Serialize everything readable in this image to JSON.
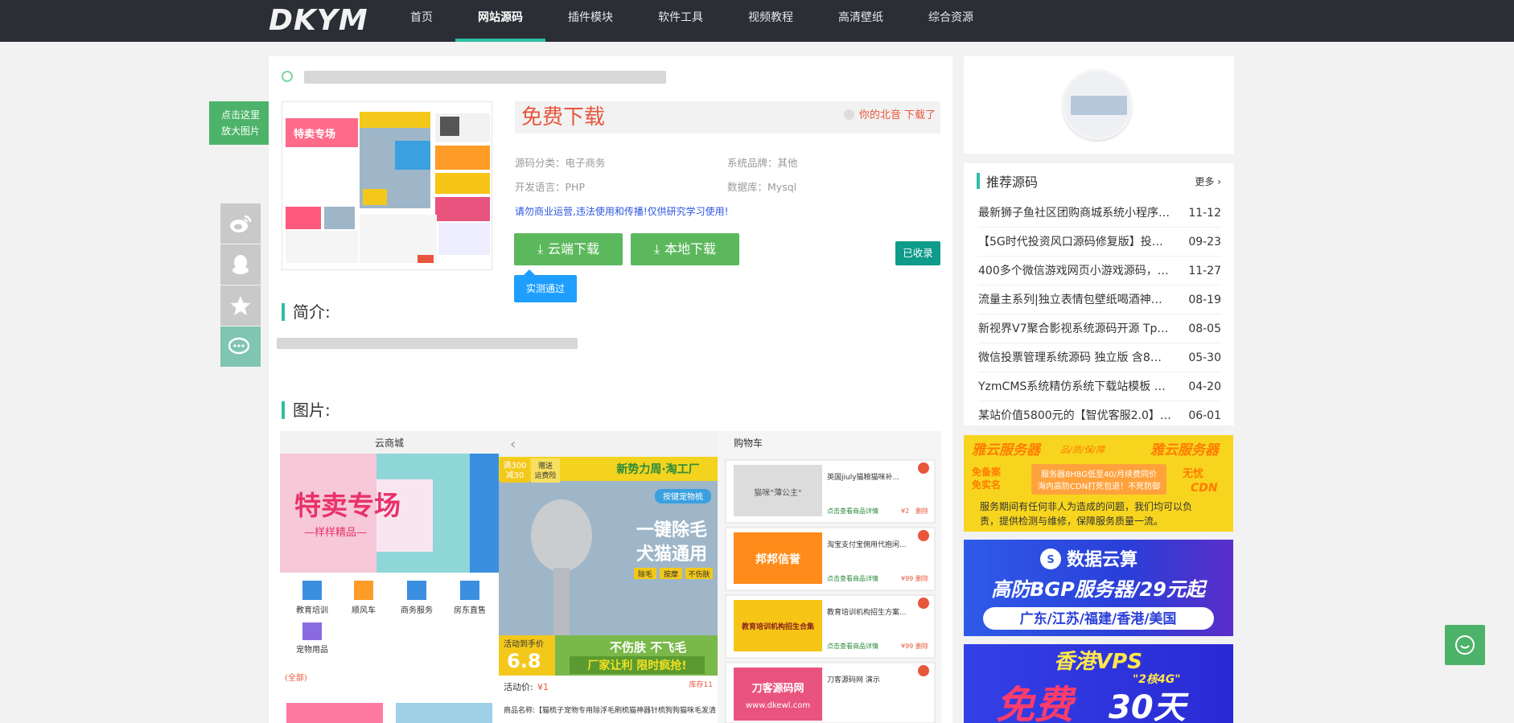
{
  "header": {
    "logo": "DKYM",
    "nav": [
      "首页",
      "网站源码",
      "插件模块",
      "软件工具",
      "视频教程",
      "高清壁纸",
      "综合资源"
    ],
    "active_nav": "网站源码"
  },
  "zoom_tip": [
    "点击这里",
    "放大图片"
  ],
  "product": {
    "free_download": "免费下载",
    "listen": "你的北音 下载了",
    "category_label": "源码分类：",
    "category": "电子商务",
    "brand_label": "系统品牌：",
    "brand": "其他",
    "language_label": "开发语言：",
    "language": "PHP",
    "db_label": "数据库：",
    "db": "Mysql",
    "notice": "请勿商业运营,违法使用和传播!仅供研究学习使用!",
    "cloud_download": "云端下载",
    "local_download": "本地下载",
    "collected": "已收录",
    "tested": "实测通过"
  },
  "sections": {
    "intro": "简介:",
    "images": "图片:"
  },
  "screenshot": {
    "col1_title": "云商城",
    "col1_banner": "特卖专场",
    "col1_banner_sub": "—样样精品—",
    "col1_icons": [
      "教育培训",
      "顺风车",
      "商务服务",
      "房东直售",
      "宠物用品"
    ],
    "col1_footer": "(全部)",
    "col2_banner_top": "新势力周·淘工厂",
    "col2_tag": "按键宠物梳",
    "col2_slogan1": "一键除毛",
    "col2_slogan2": "犬猫通用",
    "col2_badges": [
      "除毛",
      "按摩",
      "不伤肤"
    ],
    "col2_gift": "满300减30",
    "col2_gift2": "赠送运费险",
    "col2_price_tag": "活动到手价",
    "col2_price": "6.8",
    "col2_price_unit": "起",
    "col2_line1": "不伤肤 不飞毛",
    "col2_line2": "厂家让利 限时疯抢!",
    "col2_act_label": "活动价:",
    "col2_act_price": "¥1",
    "col2_stock": "库存11",
    "col2_desc": "商品名称:【猫梳子宠物专用除浮毛刷梳猫神器针梳狗狗猫咪毛发清",
    "col3_title": "购物车",
    "cart": [
      {
        "name": "英国jiuly猫粮猫咪补...",
        "tag": "JHLY",
        "title": "猫咪\"薄公主\"",
        "link": "点击查看商品详情",
        "price": "¥2",
        "del": "删除"
      },
      {
        "name": "淘宝支付宝佣用代抱闲...",
        "title": "邦邦信誉",
        "link": "点击查看商品详情",
        "price": "¥99",
        "del": "删除"
      },
      {
        "name": "教育培训机构招生方案...",
        "title": "教育培训机构招生合集",
        "link": "点击查看商品详情",
        "price": "¥99",
        "del": "删除"
      },
      {
        "name": "刀客源码网 演示",
        "title": "刀客源码网",
        "sub": "www.dkewl.com",
        "link": "点击查看商品详情",
        "price": "¥99",
        "del": "删除"
      }
    ]
  },
  "sidebar": {
    "rec_title": "推荐源码",
    "rec_more": "更多",
    "rec_items": [
      {
        "title": "最新狮子鱼社区团购商城系统小程序v1...",
        "date": "11-12"
      },
      {
        "title": "【5G时代投资风口源码修复版】投资区...",
        "date": "09-23"
      },
      {
        "title": "400多个微信游戏网页小游戏源码，测...",
        "date": "11-27"
      },
      {
        "title": "流量主系列|独立表情包壁纸喝酒神器功...",
        "date": "08-19"
      },
      {
        "title": "新视界V7聚合影视系统源码开源 Tp内...",
        "date": "08-05"
      },
      {
        "title": "微信投票管理系统源码 独立版 含8种模版",
        "date": "05-30"
      },
      {
        "title": "YzmCMS系统精仿系统下载站模板 精...",
        "date": "04-20"
      },
      {
        "title": "某站价值5800元的【智优客服2.0】|多...",
        "date": "06-01"
      }
    ],
    "ad1": {
      "brand": "雅云服务器",
      "tags": "品/质/保/障",
      "badge1": "免备案",
      "badge2": "免实名",
      "promo1": "服务器8H8G低至40/月续费同价",
      "promo2": "海内高防CDN打死包退！不死防御",
      "cdn": "CDN",
      "free": "无忧",
      "desc": "服务期间有任何非人为造成的问题，我们均可以负责，提供检测与维修，保障服务质量一流。"
    },
    "ad2": {
      "brand": "数据云算",
      "headline": "高防BGP服务器/29元起",
      "regions": "广东/江苏/福建/香港/美国"
    },
    "ad3": {
      "headline": "香港VPS",
      "sub": "\"2核4G\"",
      "free": "免费",
      "days": "30天"
    }
  }
}
